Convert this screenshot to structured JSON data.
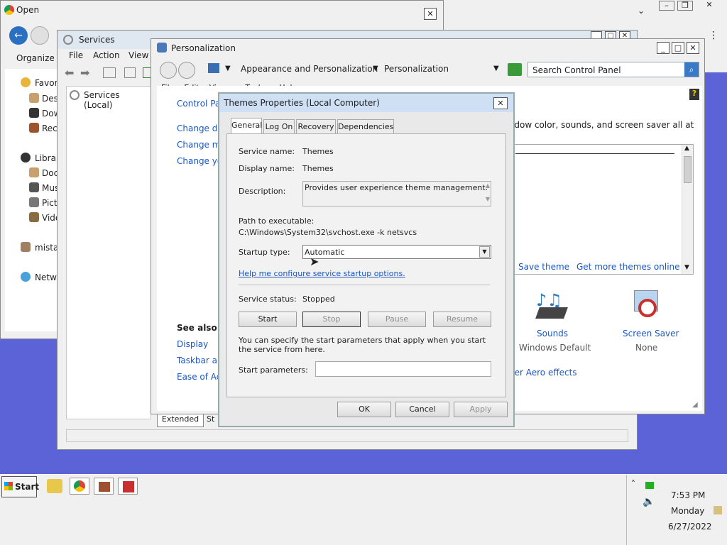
{
  "open_window": {
    "title": "Open",
    "organize_label": "Organize",
    "nav_favorites": "Favori",
    "nav_desktop": "Desk",
    "nav_downloads": "Dow",
    "nav_recent": "Rec",
    "nav_libraries": "Librar",
    "nav_documents": "Doc",
    "nav_music": "Mus",
    "nav_pictures": "Pict",
    "nav_videos": "Vide",
    "nav_user": "mistal",
    "nav_network": "Netwo"
  },
  "services_window": {
    "title": "Services",
    "menu_file": "File",
    "menu_action": "Action",
    "menu_view": "View",
    "tree_item": "Services (Local)",
    "tab_extended": "Extended",
    "tab_standard": "St"
  },
  "personalization_window": {
    "title": "Personalization",
    "breadcrumb_1": "Appearance and Personalization",
    "breadcrumb_2": "Personalization",
    "search_placeholder": "Search Control Panel",
    "menu_file": "File",
    "menu_edit": "Edit",
    "menu_view": "View",
    "menu_tools": "Tools",
    "menu_help": "Help",
    "left_home": "Control Pa",
    "left_link_1": "Change de",
    "left_link_2": "Change m",
    "left_link_3": "Change yo",
    "see_also": "See also",
    "see_display": "Display",
    "see_taskbar": "Taskbar an",
    "see_ease": "Ease of Acc",
    "intro_text": "adow color, sounds, and screen saver all at",
    "save_theme": "Save theme",
    "more_themes": "Get more themes online",
    "sounds_label": "Sounds",
    "sounds_value": "Windows Default",
    "screensaver_label": "Screen Saver",
    "screensaver_value": "None",
    "aero_link": "her Aero effects"
  },
  "dialog": {
    "title": "Themes Properties (Local Computer)",
    "tabs": [
      "General",
      "Log On",
      "Recovery",
      "Dependencies"
    ],
    "service_name_label": "Service name:",
    "service_name_value": "Themes",
    "display_name_label": "Display name:",
    "display_name_value": "Themes",
    "description_label": "Description:",
    "description_value": "Provides user experience theme management.",
    "path_label": "Path to executable:",
    "path_value": "C:\\Windows\\System32\\svchost.exe -k netsvcs",
    "startup_type_label": "Startup type:",
    "startup_type_value": "Automatic",
    "help_link": "Help me configure service startup options.",
    "status_label": "Service status:",
    "status_value": "Stopped",
    "btn_start": "Start",
    "btn_stop": "Stop",
    "btn_pause": "Pause",
    "btn_resume": "Resume",
    "params_note": "You can specify the start parameters that apply when you start the service from here.",
    "params_label": "Start parameters:",
    "params_value": "",
    "btn_ok": "OK",
    "btn_cancel": "Cancel",
    "btn_apply": "Apply"
  },
  "taskbar": {
    "start_label": "Start",
    "time": "7:53 PM",
    "day": "Monday",
    "date": "6/27/2022",
    "chevron": "˄"
  },
  "colors": {
    "desktop": "#5b63d6",
    "link": "#1a56c4",
    "title_active": "#cfe0f5"
  }
}
